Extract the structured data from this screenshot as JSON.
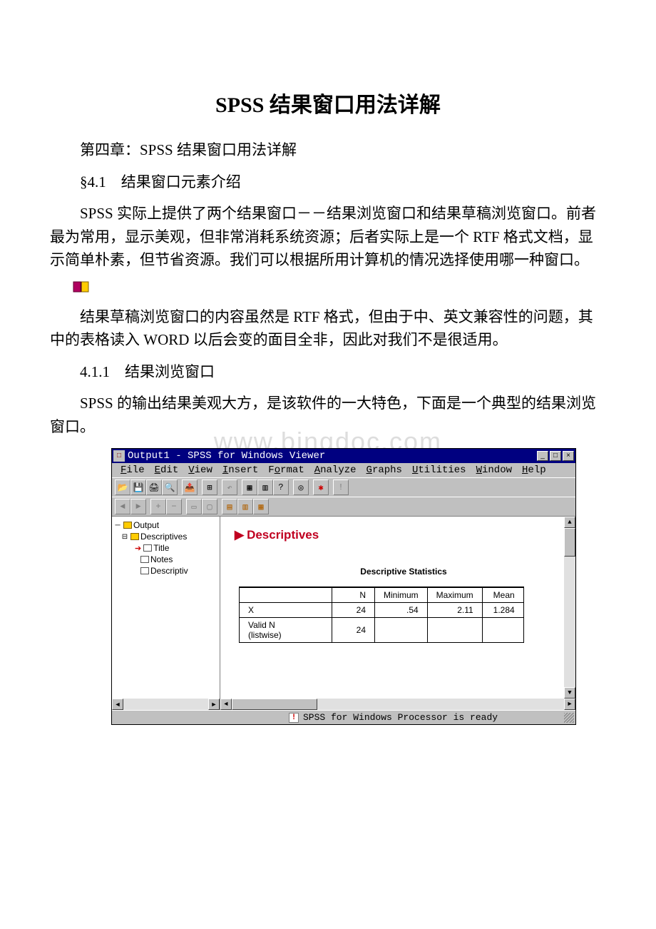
{
  "document": {
    "title": "SPSS 结果窗口用法详解",
    "chapter_line": "第四章：SPSS 结果窗口用法详解",
    "section_4_1": "§4.1　结果窗口元素介绍",
    "para1": "SPSS 实际上提供了两个结果窗口－－结果浏览窗口和结果草稿浏览窗口。前者最为常用，显示美观，但非常消耗系统资源；后者实际上是一个 RTF 格式文档，显示简单朴素，但节省资源。我们可以根据所用计算机的情况选择使用哪一种窗口。",
    "para2": "结果草稿浏览窗口的内容虽然是 RTF 格式，但由于中、英文兼容性的问题，其中的表格读入 WORD 以后会变的面目全非，因此对我们不是很适用。",
    "section_4_1_1": "4.1.1　结果浏览窗口",
    "para3": "SPSS 的输出结果美观大方，是该软件的一大特色，下面是一个典型的结果浏览窗口。",
    "watermark": "www.bingdoc.com"
  },
  "spss": {
    "title": "Output1 - SPSS for Windows Viewer",
    "window_buttons": {
      "min": "_",
      "max": "□",
      "close": "×"
    },
    "menus": [
      "File",
      "Edit",
      "View",
      "Insert",
      "Format",
      "Analyze",
      "Graphs",
      "Utilities",
      "Window",
      "Help"
    ],
    "outline": {
      "root": "Output",
      "group": "Descriptives",
      "items": [
        "Title",
        "Notes",
        "Descriptiv"
      ]
    },
    "content": {
      "heading": "Descriptives",
      "table_title": "Descriptive Statistics",
      "columns": [
        "",
        "N",
        "Minimum",
        "Maximum",
        "Mean"
      ],
      "rows": [
        {
          "label": "X",
          "n": "24",
          "min": ".54",
          "max": "2.11",
          "mean": "1.284"
        },
        {
          "label": "Valid N (listwise)",
          "n": "24",
          "min": "",
          "max": "",
          "mean": ""
        }
      ]
    },
    "status": "SPSS for Windows Processor is ready"
  }
}
